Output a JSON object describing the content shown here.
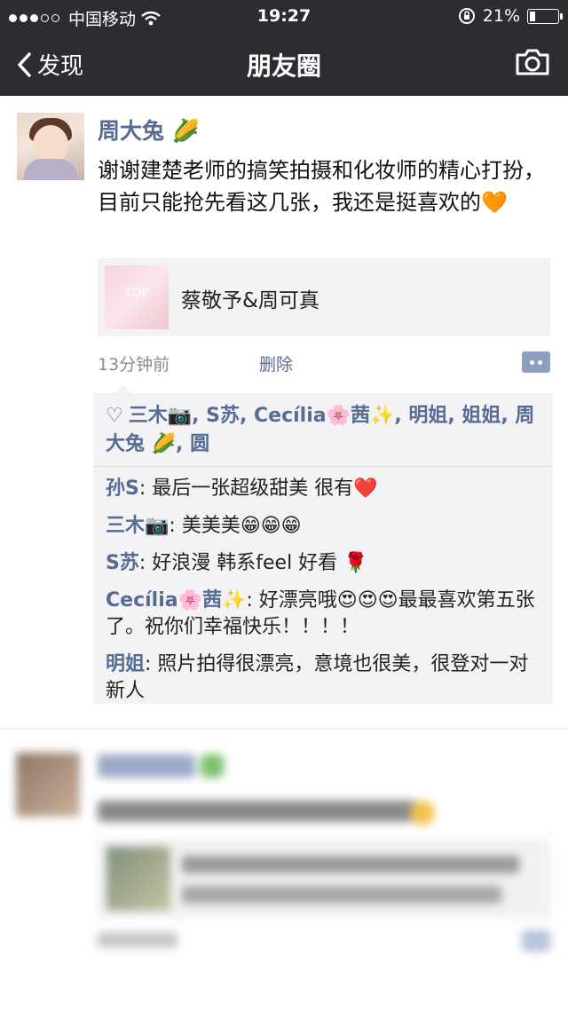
{
  "status_bar": {
    "carrier": "中国移动",
    "time": "19:27",
    "battery": "21%",
    "battery_level": 0.21
  },
  "nav": {
    "back_label": "发现",
    "title": "朋友圈"
  },
  "post": {
    "username": "周大兔 🌽",
    "text": "谢谢建楚老师的搞笑拍摄和化妆师的精心打扮，目前只能抢先看这几张，我还是挺喜欢的",
    "text_emoji": "🧡",
    "link_card": {
      "thumb_text": "TOP",
      "title": "蔡敬予&周可真"
    },
    "time_ago": "13分钟前",
    "delete_label": "删除",
    "likes": "三木📷, S苏, Cecília🌸茜✨, 明姐, 姐姐, 周大兔 🌽, 圆",
    "comments": [
      {
        "name": "孙S",
        "sep": ": ",
        "text": "最后一张超级甜美 很有",
        "emoji": "❤️"
      },
      {
        "name": "三木📷",
        "sep": ": ",
        "text": "美美美😁😁😁",
        "emoji": ""
      },
      {
        "name": "S苏",
        "sep": ": ",
        "text": "好浪漫 韩系feel 好看 🌹",
        "emoji": ""
      },
      {
        "name": "Cecília🌸茜✨",
        "sep": ": ",
        "text": "好漂亮哦😍😍😍最最喜欢第五张了。祝你们幸福快乐！！！！",
        "emoji": ""
      },
      {
        "name": "明姐",
        "sep": ": ",
        "text": "照片拍得很漂亮，意境也很美，很登对一对新人",
        "emoji": ""
      }
    ]
  },
  "colors": {
    "bar": "#2d2d31",
    "link_blue": "#576b95",
    "comment_bg": "#f3f3f5"
  }
}
